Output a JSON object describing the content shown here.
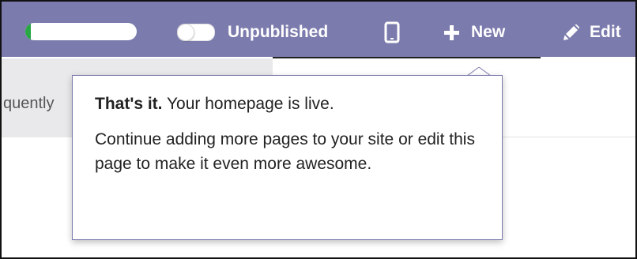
{
  "topbar": {
    "background_color": "#7c7bad",
    "progress": {
      "fraction": 0.05,
      "fill_color": "#28a745"
    },
    "publish_toggle": {
      "state": "off",
      "label": "Unpublished"
    },
    "mobile_preview_icon": "mobile-phone-icon",
    "new_button": {
      "icon": "plus-icon",
      "label": "New"
    },
    "edit_button": {
      "icon": "pencil-icon",
      "label": "Edit"
    }
  },
  "page": {
    "partial_text": "quently"
  },
  "popover": {
    "title_bold": "That's it.",
    "title_rest": " Your homepage is live.",
    "body": "Continue adding more pages to your site or edit this page to make it even more awesome.",
    "border_color": "#7c7bad"
  }
}
